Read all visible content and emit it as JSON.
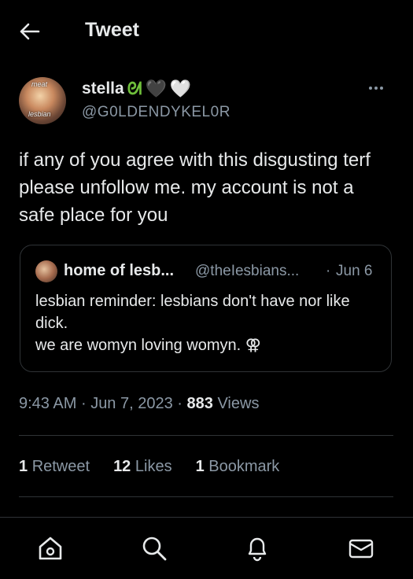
{
  "header": {
    "title": "Tweet"
  },
  "author": {
    "display_name": "stella",
    "handle": "@G0LDENDYKEL0R",
    "avatar_overlay_top": "meat",
    "avatar_overlay_bottom": "lesbian",
    "name_emojis": [
      "ᘛ",
      "🖤",
      "🤍"
    ]
  },
  "tweet": {
    "text": "if any of you agree with this disgusting terf please unfollow me. my account is not a safe place for you"
  },
  "quote": {
    "name": "home of lesb...",
    "handle": "@theIesbians...",
    "separator": "·",
    "date": "Jun 6",
    "line1": "lesbian reminder: lesbians don't have nor like dick.",
    "line2": "we are womyn loving womyn. ⚢"
  },
  "meta": {
    "time": "9:43 AM",
    "date": "Jun 7, 2023",
    "dot": "·",
    "views_count": "883",
    "views_label": "Views"
  },
  "stats": {
    "retweets_count": "1",
    "retweets_label": "Retweet",
    "likes_count": "12",
    "likes_label": "Likes",
    "bookmarks_count": "1",
    "bookmarks_label": "Bookmark"
  },
  "nav": {
    "icons": [
      "home-icon",
      "search-icon",
      "notifications-icon",
      "messages-icon"
    ]
  },
  "colors": {
    "background": "#000000",
    "text": "#e7e9ea",
    "secondary_text": "#8b98a5",
    "border": "#2f3336"
  }
}
